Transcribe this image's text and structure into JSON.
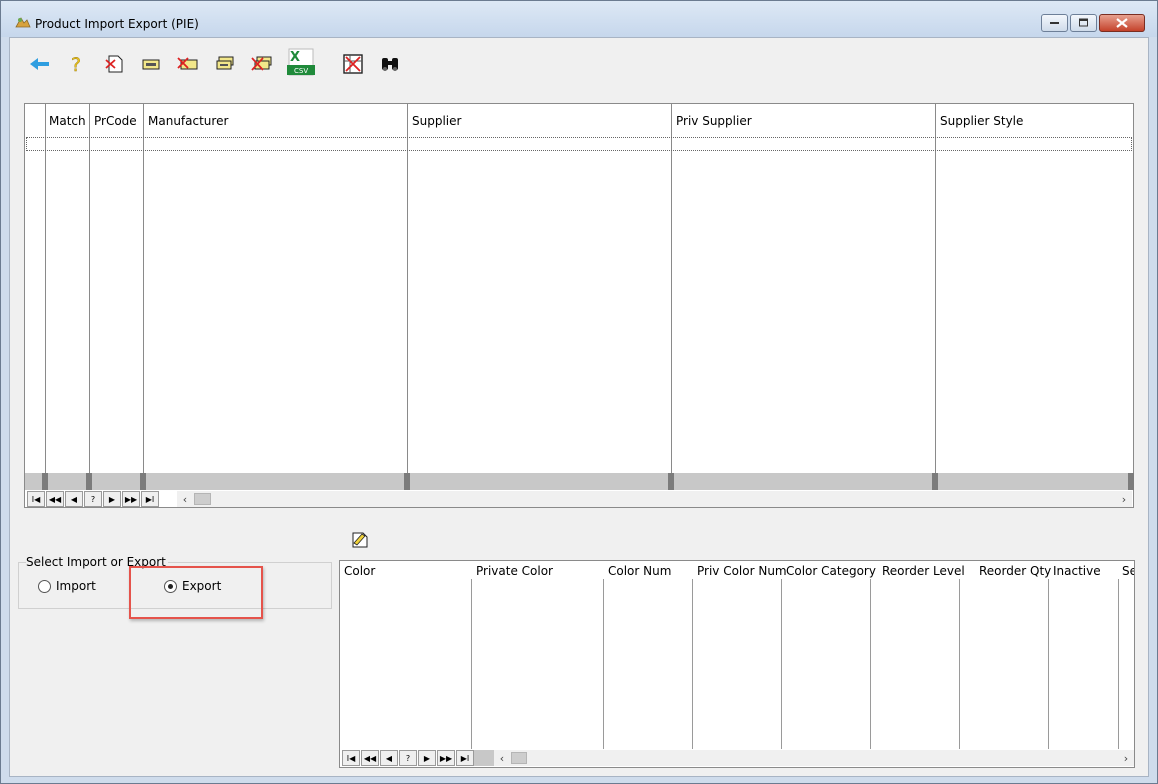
{
  "window": {
    "title": "Product Import Export (PIE)"
  },
  "toolbar": {
    "buttons": [
      {
        "name": "back-arrow-icon"
      },
      {
        "name": "help-icon"
      },
      {
        "name": "delete-document-icon"
      },
      {
        "name": "ticket-icon"
      },
      {
        "name": "delete-ticket-icon"
      },
      {
        "name": "stack-icon"
      },
      {
        "name": "delete-stack-icon"
      },
      {
        "name": "excel-csv-icon",
        "label_top": "X",
        "label_bottom": "CSV"
      },
      {
        "name": "cancel-grid-icon"
      },
      {
        "name": "binoculars-icon"
      }
    ]
  },
  "product_grid": {
    "columns": [
      "Match",
      "PrCode",
      "Manufacturer",
      "Supplier",
      "Priv Supplier",
      "Supplier Style"
    ],
    "nav_buttons": [
      "I◀",
      "◀◀",
      "◀",
      "?",
      "▶",
      "▶▶",
      "▶I"
    ]
  },
  "mode_group": {
    "label": "Select Import or Export",
    "options": [
      {
        "label": "Import",
        "selected": false
      },
      {
        "label": "Export",
        "selected": true
      }
    ]
  },
  "color_grid": {
    "columns": [
      "Color",
      "Private Color",
      "Color Num",
      "Priv Color Num",
      "Color Category",
      "Reorder Level",
      "Reorder Qty",
      "Inactive",
      "Se"
    ],
    "nav_buttons": [
      "I◀",
      "◀◀",
      "◀",
      "?",
      "▶",
      "▶▶",
      "▶I"
    ]
  },
  "colors": {
    "accent_highlight": "#e5534b",
    "grid_band": "#c8c8c8",
    "title_bg": "#cfdcec"
  }
}
